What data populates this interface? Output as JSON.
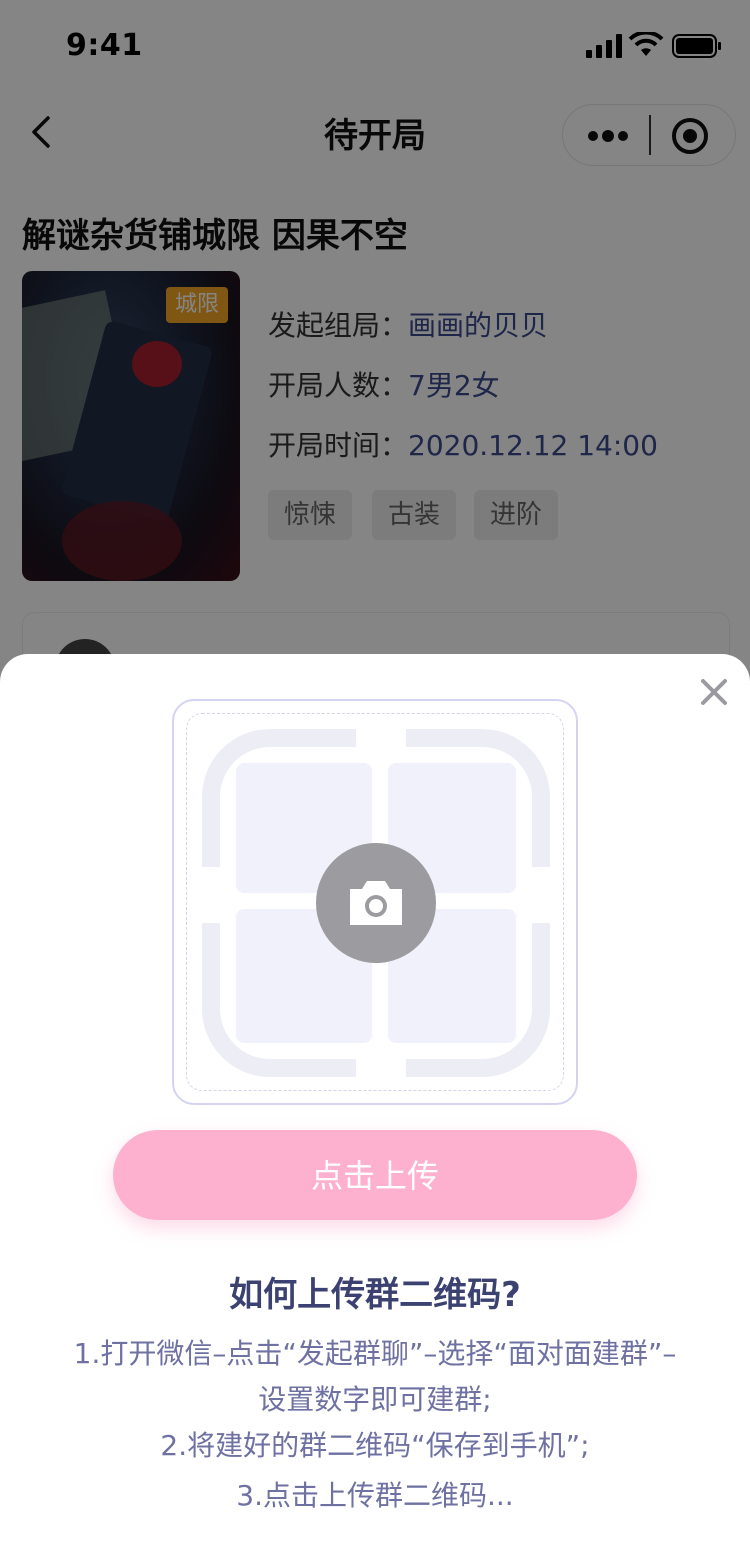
{
  "status_bar": {
    "time": "9:41"
  },
  "nav": {
    "title": "待开局"
  },
  "game": {
    "title": "解谜杂货铺城限 因果不空",
    "cover_tag": "城限",
    "info": [
      {
        "label": "发起组局：",
        "value": "画画的贝贝"
      },
      {
        "label": "开局人数：",
        "value": "7男2女"
      },
      {
        "label": "开局时间：",
        "value": "2020.12.12 14:00"
      }
    ],
    "tags": [
      "惊悚",
      "古装",
      "进阶"
    ]
  },
  "modal": {
    "upload_button": "点击上传",
    "help_title": "如何上传群二维码?",
    "help_lines": [
      "1.打开微信–点击“发起群聊”–选择“面对面建群”–",
      "设置数字即可建群;",
      "2.将建好的群二维码“保存到手机”;",
      "3.点击上传群二维码..."
    ]
  },
  "colors": {
    "accent_pink": "#fdb1cf",
    "link_blue": "#3b4a8c",
    "help_text": "#6e71a2",
    "cover_tag": "#f4a623"
  }
}
